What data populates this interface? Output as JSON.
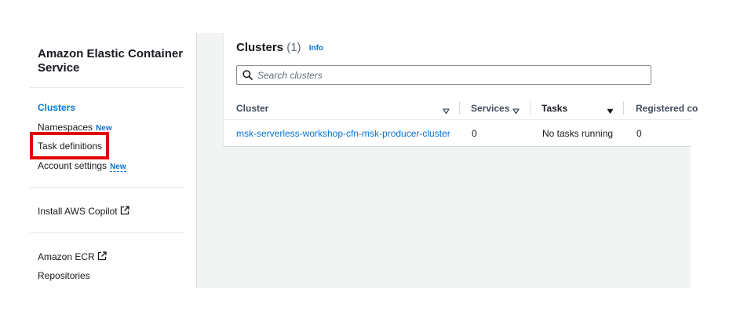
{
  "sidebar": {
    "title": "Amazon Elastic Container Service",
    "items": [
      {
        "label": "Clusters"
      },
      {
        "label": "Namespaces",
        "badge": "New"
      },
      {
        "label": "Task definitions"
      },
      {
        "label": "Account settings",
        "badge": "New"
      },
      {
        "label": "Install AWS Copilot"
      },
      {
        "label": "Amazon ECR"
      },
      {
        "label": "Repositories"
      }
    ]
  },
  "panel": {
    "title": "Clusters",
    "count": "(1)",
    "info": "Info"
  },
  "search": {
    "placeholder": "Search clusters",
    "value": ""
  },
  "table": {
    "columns": [
      "Cluster",
      "Services",
      "Tasks",
      "Registered co"
    ],
    "rows": [
      {
        "cluster": "msk-serverless-workshop-cfn-msk-producer-cluster",
        "services": "0",
        "tasks": "No tasks running",
        "registered": "0"
      }
    ]
  },
  "colors": {
    "accent": "#0972d3",
    "highlight": "#e00000",
    "background": "#f2f3f3"
  }
}
